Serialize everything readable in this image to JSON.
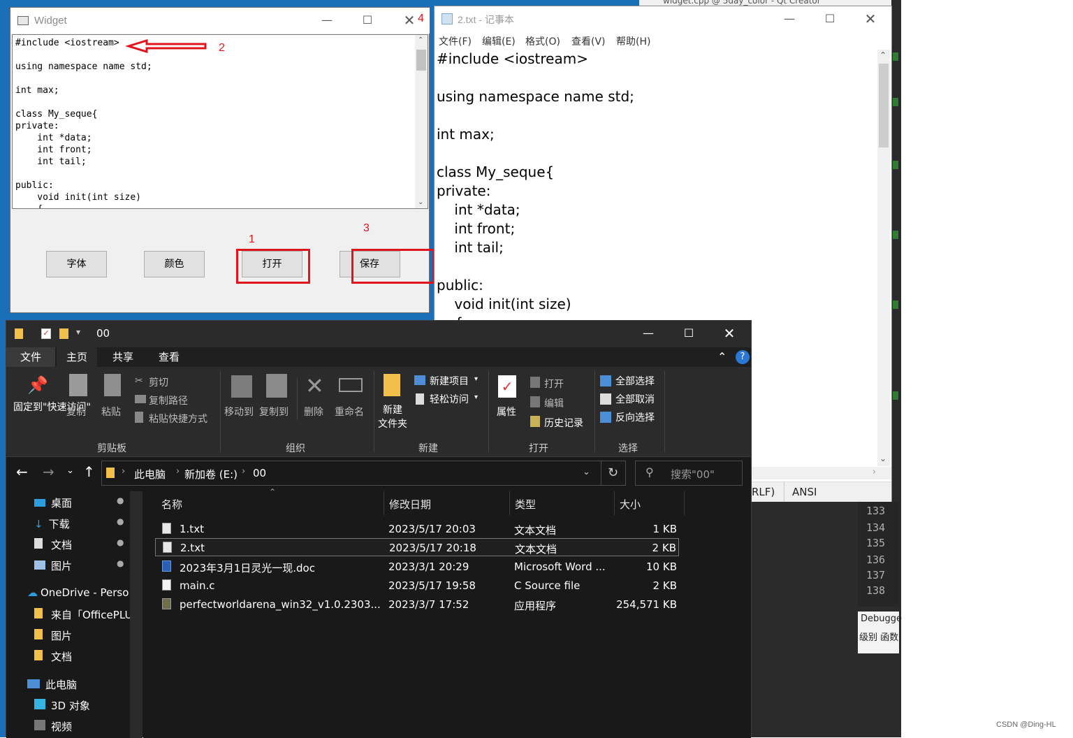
{
  "background": {
    "qt_title": "widget.cpp @ 5day_color - Qt Creator",
    "line_numbers": [
      "133",
      "134",
      "135",
      "136",
      "137",
      "138"
    ],
    "debug_title": "Debugge",
    "debug_sub": "级别 函数",
    "watermark": "CSDN @Ding-HL"
  },
  "widget": {
    "title": "Widget",
    "text": "#include <iostream>\n\nusing namespace name std;\n\nint max;\n\nclass My_seque{\nprivate:\n    int *data;\n    int front;\n    int tail;\n\npublic:\n    void init(int size)\n    {",
    "buttons": {
      "font": "字体",
      "color": "颜色",
      "open": "打开",
      "save": "保存"
    }
  },
  "annotations": {
    "n1": "1",
    "n2": "2",
    "n3": "3",
    "n4": "4",
    "color": "#e0141c"
  },
  "notepad": {
    "title": "2.txt - 记事本",
    "menu": [
      "文件(F)",
      "编辑(E)",
      "格式(O)",
      "查看(V)",
      "帮助(H)"
    ],
    "text": "#include <iostream>\n\nusing namespace name std;\n\nint max;\n\nclass My_seque{\nprivate:\n    int *data;\n    int front;\n    int tail;\n\npublic:\n    void init(int size)\n    {",
    "status_eol": "RLF)",
    "status_enc": "ANSI"
  },
  "explorer": {
    "title": "00",
    "tabs": [
      "文件",
      "主页",
      "共享",
      "查看"
    ],
    "ribbon": {
      "pin": "固定到\"快速访问\"",
      "copy": "复制",
      "paste": "粘贴",
      "cut": "剪切",
      "copy_path": "复制路径",
      "paste_shortcut": "粘贴快捷方式",
      "move_to": "移动到",
      "copy_to": "复制到",
      "delete": "删除",
      "rename": "重命名",
      "new_folder": "新建\n文件夹",
      "new_item": "新建项目",
      "easy_access": "轻松访问",
      "properties": "属性",
      "open": "打开",
      "edit": "编辑",
      "history": "历史记录",
      "select_all": "全部选择",
      "select_none": "全部取消",
      "invert": "反向选择",
      "groups": [
        "剪贴板",
        "组织",
        "新建",
        "打开",
        "选择"
      ]
    },
    "address": {
      "pc": "此电脑",
      "drive": "新加卷 (E:)",
      "folder": "00"
    },
    "search_placeholder": "搜索\"00\"",
    "nav": [
      "桌面",
      "下载",
      "文档",
      "图片",
      "OneDrive - Perso",
      "来自「OfficePLU",
      "图片",
      "文档",
      "此电脑",
      "3D 对象",
      "视频"
    ],
    "columns": [
      "名称",
      "修改日期",
      "类型",
      "大小"
    ],
    "files": [
      {
        "name": "1.txt",
        "date": "2023/5/17 20:03",
        "type": "文本文档",
        "size": "1 KB"
      },
      {
        "name": "2.txt",
        "date": "2023/5/17 20:18",
        "type": "文本文档",
        "size": "2 KB"
      },
      {
        "name": "2023年3月1日灵光一现.doc",
        "date": "2023/3/1 20:29",
        "type": "Microsoft Word ...",
        "size": "10 KB"
      },
      {
        "name": "main.c",
        "date": "2023/5/17 19:58",
        "type": "C Source file",
        "size": "2 KB"
      },
      {
        "name": "perfectworldarena_win32_v1.0.2303...",
        "date": "2023/3/7 17:52",
        "type": "应用程序",
        "size": "254,571 KB"
      }
    ]
  }
}
